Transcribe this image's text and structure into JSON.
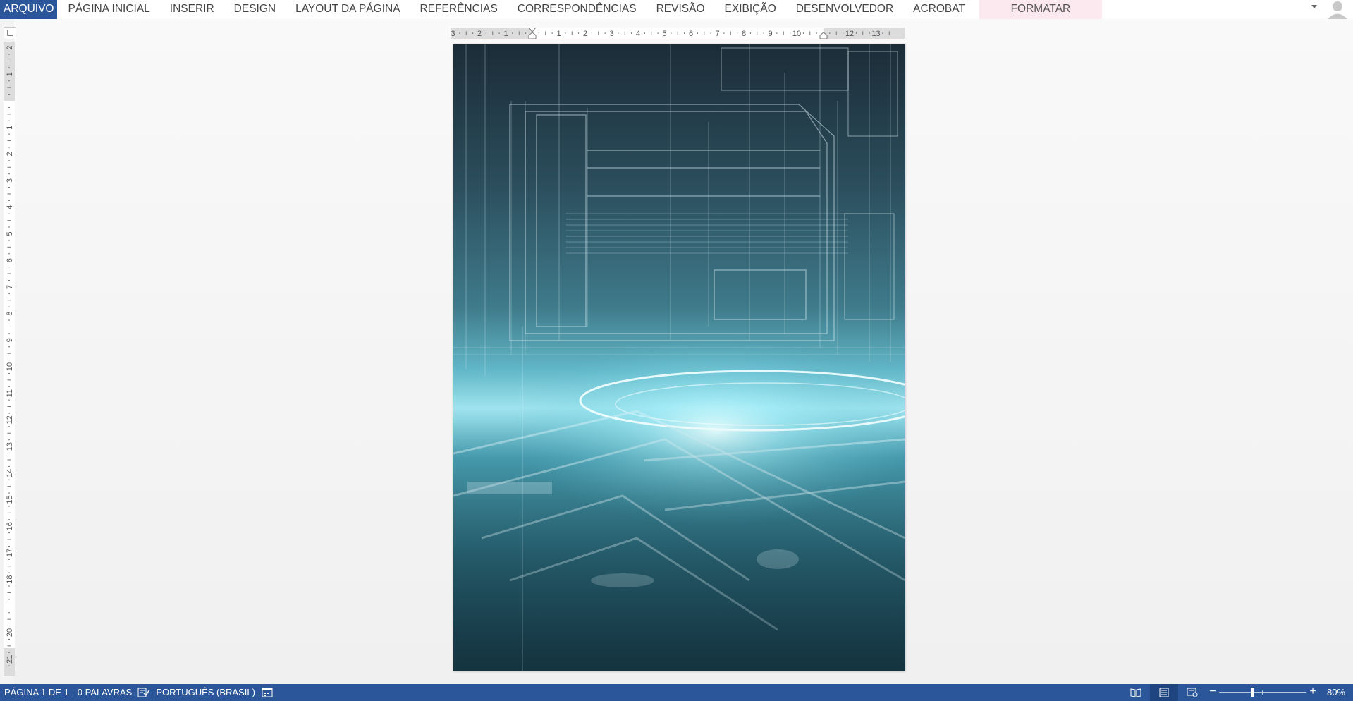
{
  "ribbon": {
    "tabs": [
      {
        "label": "ARQUIVO"
      },
      {
        "label": "PÁGINA INICIAL"
      },
      {
        "label": "INSERIR"
      },
      {
        "label": "DESIGN"
      },
      {
        "label": "LAYOUT DA PÁGINA"
      },
      {
        "label": "REFERÊNCIAS"
      },
      {
        "label": "CORRESPONDÊNCIAS"
      },
      {
        "label": "REVISÃO"
      },
      {
        "label": "EXIBIÇÃO"
      },
      {
        "label": "DESENVOLVEDOR"
      },
      {
        "label": "ACROBAT"
      }
    ],
    "contextual_tab": "FORMATAR",
    "ribbon_toggle_icon": "chevron-down-icon",
    "account_icon": "user-avatar-icon"
  },
  "rulers": {
    "horizontal_labels": [
      "3",
      "2",
      "1",
      "1",
      "2",
      "3",
      "4",
      "5",
      "6",
      "7",
      "8",
      "9",
      "10",
      "12",
      "13"
    ],
    "vertical_labels": [
      "2",
      "1",
      "1",
      "2",
      "3",
      "4",
      "5",
      "6",
      "7",
      "8",
      "9",
      "10",
      "11",
      "12",
      "13",
      "14",
      "15",
      "16",
      "17",
      "18",
      "20",
      "21"
    ]
  },
  "document": {
    "page_content": "technology-blueprint-background-image"
  },
  "statusbar": {
    "page_info": "PÁGINA 1 DE 1",
    "word_count": "0 PALAVRAS",
    "language": "PORTUGUÊS (BRASIL)",
    "proofing_icon": "proofing-check-icon",
    "macro_icon": "macro-record-icon",
    "views": [
      "read-mode-icon",
      "print-layout-icon",
      "web-layout-icon"
    ],
    "zoom_minus": "−",
    "zoom_plus": "+",
    "zoom_level": "80%",
    "zoom_fraction": 0.8
  },
  "colors": {
    "brand": "#2b579a",
    "contextual_tab_bg": "#fbe9ef",
    "canvas_bg": "#f3f3f3"
  }
}
